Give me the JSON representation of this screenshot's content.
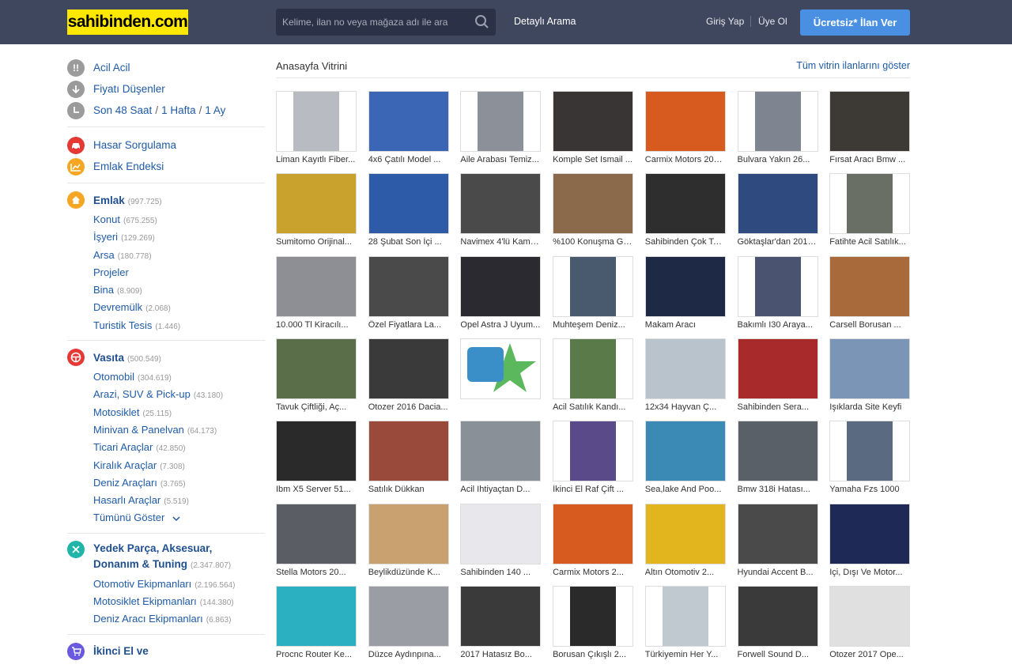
{
  "header": {
    "logo": "sahibinden.com",
    "search_placeholder": "Kelime, ilan no veya mağaza adı ile ara",
    "detailed_search": "Detaylı Arama",
    "login": "Giriş Yap",
    "register": "Üye Ol",
    "post_ad": "Ücretsiz* İlan Ver"
  },
  "sidebar": {
    "quick": [
      {
        "label": "Acil Acil",
        "icon": "exclamation-icon",
        "color": "#9b9b9b"
      },
      {
        "label": "Fiyatı Düşenler",
        "icon": "arrow-down-icon",
        "color": "#9b9b9b"
      },
      {
        "label": "Son 48 Saat",
        "extra": [
          "1 Hafta",
          "1 Ay"
        ],
        "icon": "clock-icon",
        "color": "#9b9b9b"
      }
    ],
    "tools": [
      {
        "label": "Hasar Sorgulama",
        "icon": "car-damage-icon",
        "color": "#e53935"
      },
      {
        "label": "Emlak Endeksi",
        "icon": "chart-icon",
        "color": "#f5a623"
      }
    ],
    "emlak": {
      "title": "Emlak",
      "count": "(997.725)",
      "icon": "house-icon",
      "color": "#f5a623",
      "items": [
        {
          "label": "Konut",
          "count": "(675.255)"
        },
        {
          "label": "İşyeri",
          "count": "(129.269)"
        },
        {
          "label": "Arsa",
          "count": "(180.778)"
        },
        {
          "label": "Projeler",
          "count": ""
        },
        {
          "label": "Bina",
          "count": "(8.909)"
        },
        {
          "label": "Devremülk",
          "count": "(2.068)"
        },
        {
          "label": "Turistik Tesis",
          "count": "(1.446)"
        }
      ]
    },
    "vasita": {
      "title": "Vasıta",
      "count": "(500.549)",
      "icon": "steering-wheel-icon",
      "color": "#e53935",
      "items": [
        {
          "label": "Otomobil",
          "count": "(304.619)"
        },
        {
          "label": "Arazi, SUV & Pick-up",
          "count": "(43.180)"
        },
        {
          "label": "Motosiklet",
          "count": "(25.115)"
        },
        {
          "label": "Minivan & Panelvan",
          "count": "(64.173)"
        },
        {
          "label": "Ticari Araçlar",
          "count": "(42.850)"
        },
        {
          "label": "Kiralık Araçlar",
          "count": "(7.308)"
        },
        {
          "label": "Deniz Araçları",
          "count": "(3.765)"
        },
        {
          "label": "Hasarlı Araçlar",
          "count": "(5.519)"
        }
      ],
      "show_all": "Tümünü Göster"
    },
    "yedek": {
      "title_line1": "Yedek Parça, Aksesuar,",
      "title_line2": "Donanım & Tuning",
      "count": "(2.347.807)",
      "icon": "wrench-icon",
      "color": "#1fb5a8",
      "items": [
        {
          "label": "Otomotiv Ekipmanları",
          "count": "(2.196.564)"
        },
        {
          "label": "Motosiklet Ekipmanları",
          "count": "(144.380)"
        },
        {
          "label": "Deniz Aracı Ekipmanları",
          "count": "(6.863)"
        }
      ]
    },
    "ikinci": {
      "title": "İkinci El ve",
      "icon": "cart-icon",
      "color": "#6a5ae0"
    }
  },
  "main": {
    "heading": "Anasayfa Vitrini",
    "show_all": "Tüm vitrin ilanlarını göster",
    "items": [
      {
        "title": "Liman Kayıtlı Fiber...",
        "color": "#b8bcc2",
        "img": "narrow"
      },
      {
        "title": "4x6 Çatılı Model ...",
        "color": "#3a66b5",
        "img": "full"
      },
      {
        "title": "Aile Arabası Temiz...",
        "color": "#8b9099",
        "img": "narrow"
      },
      {
        "title": "Komple Set Ismail ...",
        "color": "#3a3535",
        "img": "full"
      },
      {
        "title": "Carmix Motors 2017...",
        "color": "#d75a1e",
        "img": "full"
      },
      {
        "title": "Bulvara Yakın 26...",
        "color": "#7e8590",
        "img": "narrow"
      },
      {
        "title": "Fırsat Aracı Bmw ...",
        "color": "#3d3a35",
        "img": "full"
      },
      {
        "title": "Sumitomo Orijinal...",
        "color": "#c9a12d",
        "img": "full"
      },
      {
        "title": "28 Şubat Son İçi ...",
        "color": "#2d5ba8",
        "img": "full"
      },
      {
        "title": "Navimex 4'lü Kamp...",
        "color": "#4a4a4a",
        "img": "full"
      },
      {
        "title": "%100 Konuşma Garan...",
        "color": "#8a6a4a",
        "img": "full"
      },
      {
        "title": "Sahibinden Çok Tem...",
        "color": "#2e2e2e",
        "img": "full"
      },
      {
        "title": "Göktaşlar'dan 2017...",
        "color": "#2f4a7e",
        "img": "full"
      },
      {
        "title": "Fatihte Acil Satılık...",
        "color": "#6a6f66",
        "img": "narrow"
      },
      {
        "title": "10.000 Tl Kiracılı...",
        "color": "#8d8f94",
        "img": "full"
      },
      {
        "title": "Özel Fiyatlara La...",
        "color": "#4a4a4a",
        "img": "full"
      },
      {
        "title": "Opel Astra J Uyum...",
        "color": "#2a2a30",
        "img": "full"
      },
      {
        "title": "Muhteşem Deniz...",
        "color": "#4a5a6e",
        "img": "narrow"
      },
      {
        "title": "Makam Aracı",
        "color": "#1e2a45",
        "img": "full"
      },
      {
        "title": "Bakımlı I30 Araya...",
        "color": "#4a5470",
        "img": "narrow"
      },
      {
        "title": "Carsell Borusan ...",
        "color": "#a86a3a",
        "img": "full"
      },
      {
        "title": "Tavuk Çiftliği, Aç...",
        "color": "#5a6e4a",
        "img": "full"
      },
      {
        "title": "Otozer 2016 Dacia...",
        "color": "#3a3a3a",
        "img": "full"
      },
      {
        "title": "",
        "color": "#3a8fc9",
        "img": "badge"
      },
      {
        "title": "Acil Satılık Kandı...",
        "color": "#5a7a4a",
        "img": "narrow"
      },
      {
        "title": "12x34 Hayvan Ç...",
        "color": "#b9c3cc",
        "img": "full"
      },
      {
        "title": "Sahibinden Sera...",
        "color": "#a82a2a",
        "img": "full"
      },
      {
        "title": "Işıklarda Site Keyfi",
        "color": "#7a95b5",
        "img": "full"
      },
      {
        "title": "Ibm X5 Server 51...",
        "color": "#2a2a2a",
        "img": "full"
      },
      {
        "title": "Satılık Dükkan",
        "color": "#9a4a3a",
        "img": "full"
      },
      {
        "title": "Acil Ihtiyaçtan D...",
        "color": "#8a9098",
        "img": "full"
      },
      {
        "title": "İkinci El Raf Çift ...",
        "color": "#5a4a8a",
        "img": "narrow"
      },
      {
        "title": "Sea,lake And Poo...",
        "color": "#3a8ab5",
        "img": "full"
      },
      {
        "title": "Bmw 318i Hatası...",
        "color": "#5a6068",
        "img": "full"
      },
      {
        "title": "Yamaha Fzs 1000",
        "color": "#5a6a80",
        "img": "narrow"
      },
      {
        "title": "Stella Motors 20...",
        "color": "#5a5e64",
        "img": "full"
      },
      {
        "title": "Beylikdüzünde K...",
        "color": "#c9a070",
        "img": "full"
      },
      {
        "title": "Sahibinden 140 ...",
        "color": "#e8e8ec",
        "img": "full"
      },
      {
        "title": "Carmix Motors 2...",
        "color": "#d75a1e",
        "img": "full"
      },
      {
        "title": "Altın Otomotiv 2...",
        "color": "#e2b41e",
        "img": "full"
      },
      {
        "title": "Hyundai Accent B...",
        "color": "#4a4a4a",
        "img": "full"
      },
      {
        "title": "Içi, Dışı Ve Motor...",
        "color": "#1e2a55",
        "img": "full"
      },
      {
        "title": "Procnc Router Ke...",
        "color": "#2ab0c0",
        "img": "full"
      },
      {
        "title": "Düzce Aydınpına...",
        "color": "#9a9ea4",
        "img": "full"
      },
      {
        "title": "2017 Hatasız Bo...",
        "color": "#3a3a3a",
        "img": "full"
      },
      {
        "title": "Borusan Çıkışlı 2...",
        "color": "#2a2a2a",
        "img": "narrow"
      },
      {
        "title": "Türkiyemin Her Y...",
        "color": "#c0c8d0",
        "img": "narrow"
      },
      {
        "title": "Forwell Sound D...",
        "color": "#3a3a3a",
        "img": "full"
      },
      {
        "title": "Otozer 2017 Ope...",
        "color": "#e0e0e0",
        "img": "full"
      }
    ]
  }
}
